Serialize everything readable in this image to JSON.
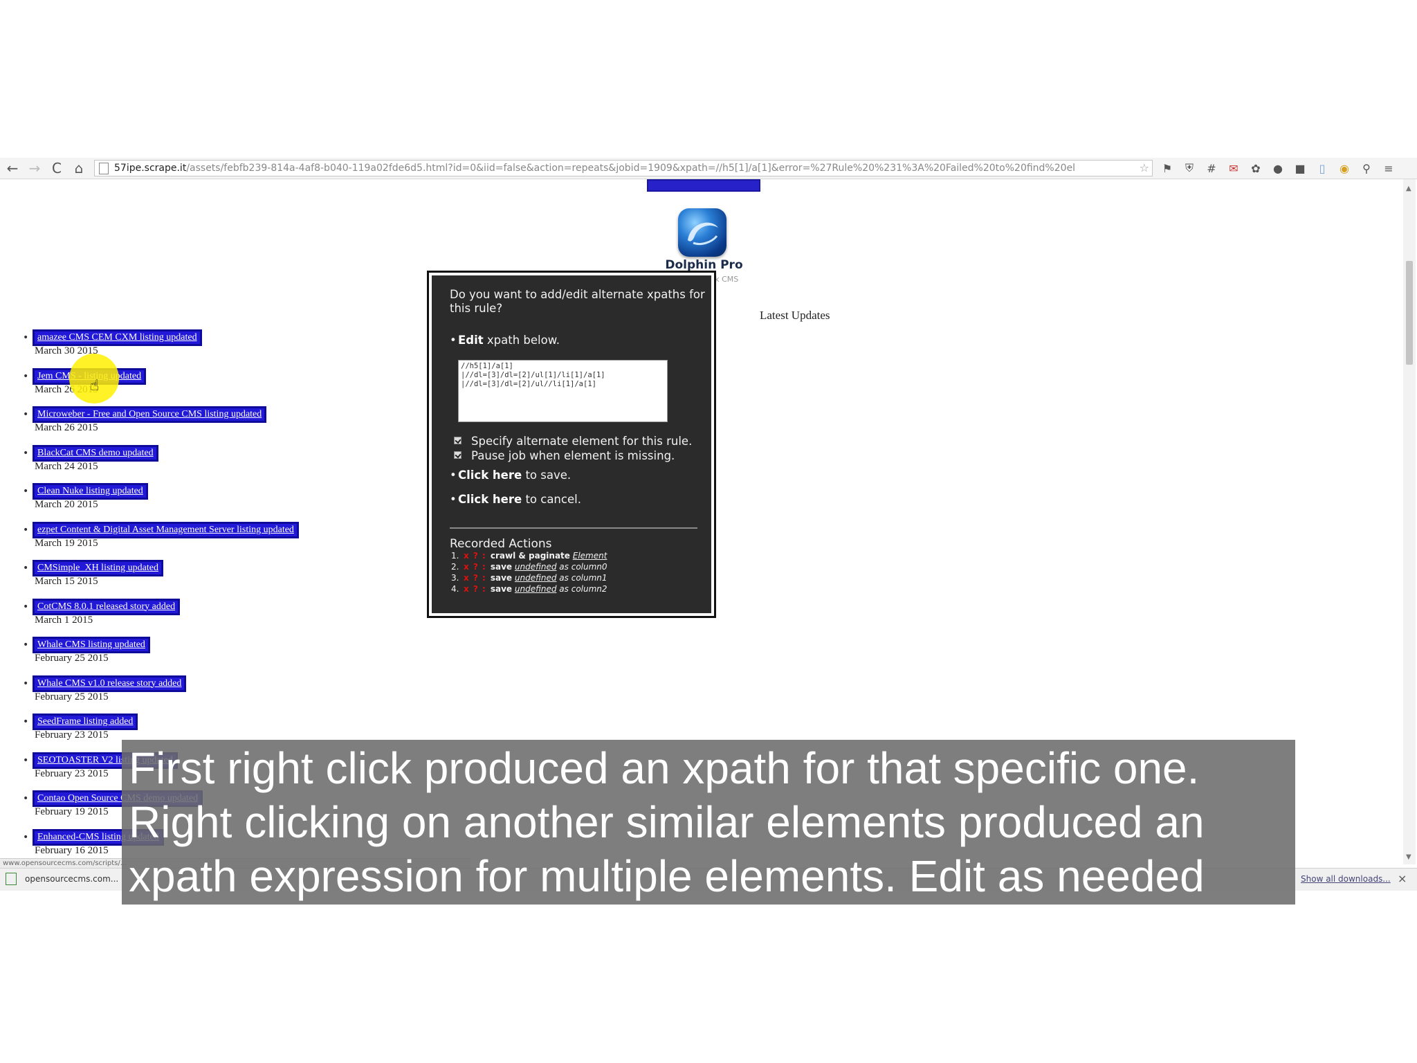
{
  "browser": {
    "url_host": "57ipe.scrape.it",
    "url_path": "/assets/febfb239-814a-4af8-b040-119a02fde6d5.html?id=0&iid=false&action=repeats&jobid=1909&xpath=//h5[1]/a[1]&error=%27Rule%20%231%3A%20Failed%20to%20find%20el",
    "nav": {
      "back": "←",
      "forward": "→",
      "reload": "C",
      "home": "⌂"
    },
    "extension_icons": [
      "bookmark-icon",
      "shield-icon",
      "grid-icon",
      "gmail-icon",
      "puzzle-icon",
      "circle-icon",
      "square-icon",
      "doc-icon",
      "chrome-icon",
      "search-icon",
      "menu-icon"
    ]
  },
  "page": {
    "dolphin_name": "Dolphin Pro",
    "dolphin_sub": "ork CMS",
    "latest_updates": "Latest Updates",
    "updates": [
      {
        "link": "amazee CMS CEM CXM listing updated",
        "date": "March 30 2015"
      },
      {
        "link": "Jem CMS - listing updated",
        "date": "March 26 2015"
      },
      {
        "link": "Microweber - Free and Open Source CMS listing updated",
        "date": "March 26 2015"
      },
      {
        "link": "BlackCat CMS demo updated",
        "date": "March 24 2015"
      },
      {
        "link": "Clean Nuke listing updated",
        "date": "March 20 2015"
      },
      {
        "link": "ezpet Content & Digital Asset Management Server listing updated",
        "date": "March 19 2015"
      },
      {
        "link": "CMSimple_XH listing updated",
        "date": "March 15 2015"
      },
      {
        "link": "CotCMS 8.0.1 released story added",
        "date": "March 1 2015"
      },
      {
        "link": "Whale CMS listing updated",
        "date": "February 25 2015"
      },
      {
        "link": "Whale CMS v1.0 release story added",
        "date": "February 25 2015"
      },
      {
        "link": "SeedFrame listing added",
        "date": "February 23 2015"
      },
      {
        "link": "SEOTOASTER V2 listing updated",
        "date": "February 23 2015"
      },
      {
        "link": "Contao Open Source CMS demo updated",
        "date": "February 19 2015"
      },
      {
        "link": "Enhanced-CMS listing updated",
        "date": "February 16 2015"
      }
    ]
  },
  "dialog": {
    "question": "Do you want to add/edit alternate xpaths for this rule?",
    "edit_bold": "Edit",
    "edit_rest": "xpath below.",
    "xpath_lines": [
      "//h5[1]/a[1]",
      "|//dl=[3]/dl=[2]/ul[1]/li[1]/a[1]",
      "|//dl=[3]/dl=[2]/ul//li[1]/a[1]"
    ],
    "check1": "Specify alternate element for this rule.",
    "check2": "Pause job when element is missing.",
    "save_bold": "Click here",
    "save_rest": "to save.",
    "cancel_bold": "Click here",
    "cancel_rest": "to cancel.",
    "recorded_title": "Recorded Actions",
    "actions": [
      {
        "num": "1.",
        "marks": "x ? :",
        "cmd": "crawl & paginate",
        "arg": "Element",
        "tail": ""
      },
      {
        "num": "2.",
        "marks": "x ? :",
        "cmd": "save",
        "arg": "undefined",
        "tail": "as column0"
      },
      {
        "num": "3.",
        "marks": "x ? :",
        "cmd": "save",
        "arg": "undefined",
        "tail": "as column1"
      },
      {
        "num": "4.",
        "marks": "x ? :",
        "cmd": "save",
        "arg": "undefined",
        "tail": "as column2"
      }
    ]
  },
  "status_url": "www.opensourcecms.com/scripts/...",
  "downloads": {
    "item": "opensourcecms.com...",
    "show_all": "Show all downloads...",
    "close": "×"
  },
  "caption": [
    "First right click produced an xpath for that specific one.",
    "Right clicking on another similar elements produced an",
    "xpath expression for multiple elements. Edit as needed"
  ]
}
